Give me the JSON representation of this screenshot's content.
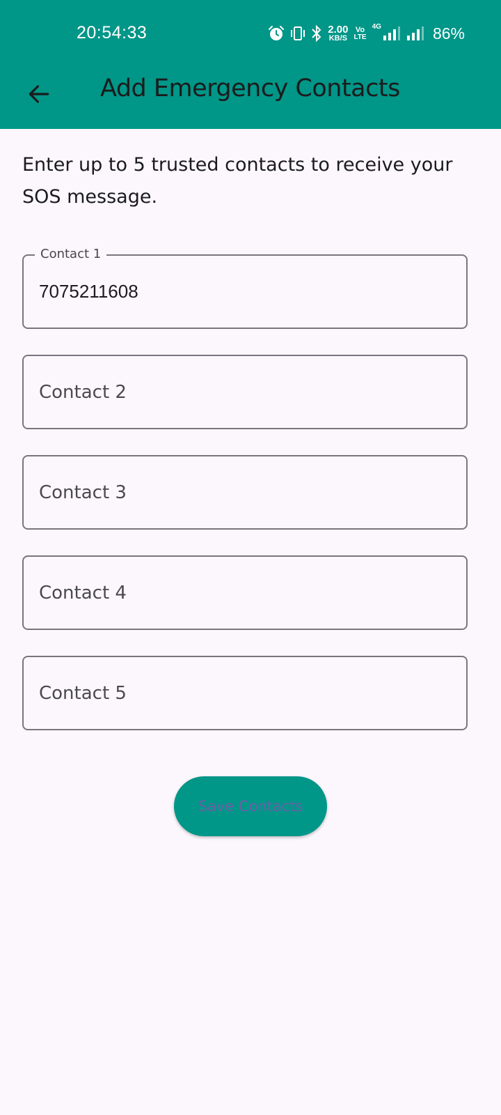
{
  "status_bar": {
    "time": "20:54:33",
    "net_speed_value": "2.00",
    "net_speed_unit": "KB/S",
    "volte_top": "Vo",
    "volte_bottom": "LTE",
    "network_type": "4G",
    "battery": "86%",
    "icons": [
      "alarm-icon",
      "vibrate-icon",
      "bluetooth-icon",
      "signal-icon",
      "signal-icon"
    ],
    "color": "#ffffff"
  },
  "app_bar": {
    "title": "Add Emergency Contacts",
    "back_icon": "arrow-back-icon",
    "background": "#009688"
  },
  "main": {
    "instructions": "Enter up to 5 trusted contacts to receive your SOS message.",
    "contacts": [
      {
        "label": "Contact 1",
        "value": "7075211608",
        "placeholder": ""
      },
      {
        "label": "Contact 2",
        "value": "",
        "placeholder": "Contact 2"
      },
      {
        "label": "Contact 3",
        "value": "",
        "placeholder": "Contact 3"
      },
      {
        "label": "Contact 4",
        "value": "",
        "placeholder": "Contact 4"
      },
      {
        "label": "Contact 5",
        "value": "",
        "placeholder": "Contact 5"
      }
    ],
    "save_button_label": "Save Contacts"
  },
  "colors": {
    "accent": "#009688",
    "background": "#fcf7fd",
    "field_border": "#79747e"
  }
}
